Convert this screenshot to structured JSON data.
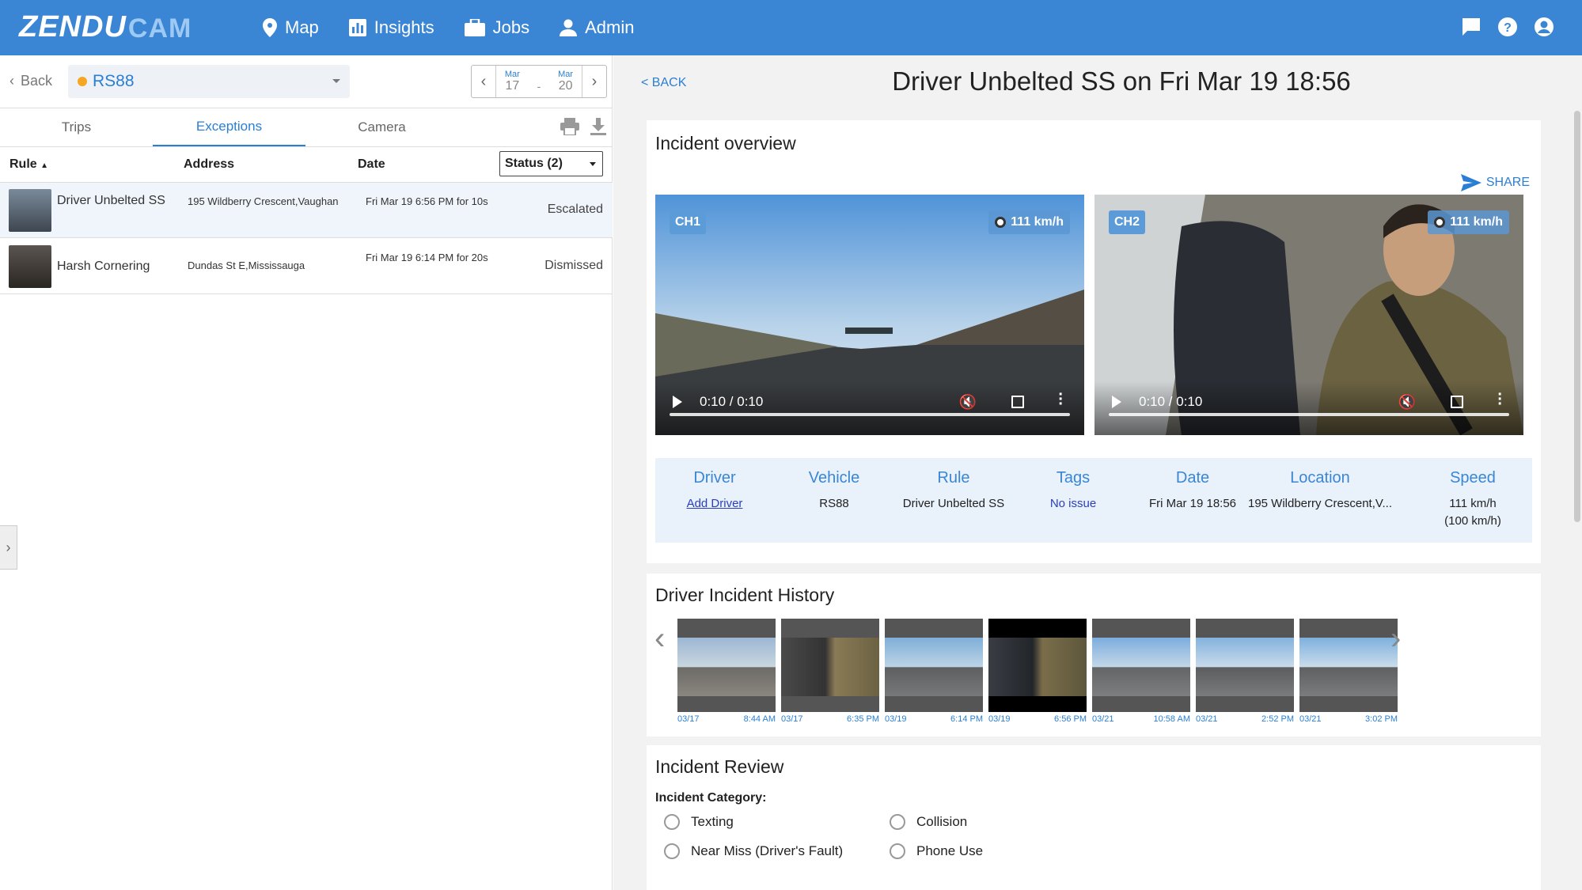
{
  "brand": {
    "part1": "ZENDU",
    "part2": "CAM"
  },
  "nav": [
    {
      "label": "Map",
      "icon": "map-pin-icon"
    },
    {
      "label": "Insights",
      "icon": "bar-chart-icon"
    },
    {
      "label": "Jobs",
      "icon": "briefcase-icon"
    },
    {
      "label": "Admin",
      "icon": "user-icon"
    }
  ],
  "left": {
    "back_label": "Back",
    "vehicle": "RS88",
    "date_from": {
      "month": "Mar",
      "day": "17"
    },
    "date_to": {
      "month": "Mar",
      "day": "20"
    },
    "date_sep": "-",
    "tabs": [
      "Trips",
      "Exceptions",
      "Camera"
    ],
    "columns": {
      "rule": "Rule",
      "address": "Address",
      "date": "Date",
      "status_filter": "Status (2)"
    },
    "rows": [
      {
        "rule": "Driver Unbelted SS",
        "address": "195 Wildberry Crescent,Vaughan",
        "date": "Fri Mar 19 6:56 PM for 10s",
        "status": "Escalated"
      },
      {
        "rule": "Harsh Cornering",
        "address": "Dundas St E,Mississauga",
        "date": "Fri Mar 19 6:14 PM for 20s",
        "status": "Dismissed"
      }
    ]
  },
  "right": {
    "back_label": "< BACK",
    "title": "Driver Unbelted SS on Fri Mar 19 18:56",
    "overview": {
      "heading": "Incident overview",
      "share_label": "SHARE",
      "videos": [
        {
          "channel": "CH1",
          "speed": "111 km/h",
          "time": "0:10 / 0:10"
        },
        {
          "channel": "CH2",
          "speed": "111 km/h",
          "time": "0:10 / 0:10"
        }
      ],
      "info": {
        "driver": {
          "label": "Driver",
          "value": "Add Driver"
        },
        "vehicle": {
          "label": "Vehicle",
          "value": "RS88"
        },
        "rule": {
          "label": "Rule",
          "value": "Driver Unbelted SS"
        },
        "tags": {
          "label": "Tags",
          "value": "No issue"
        },
        "date": {
          "label": "Date",
          "value": "Fri Mar 19 18:56"
        },
        "location": {
          "label": "Location",
          "value": "195 Wildberry Crescent,V..."
        },
        "speed": {
          "label": "Speed",
          "value": "111 km/h",
          "value2": "(100 km/h)"
        }
      }
    },
    "history": {
      "heading": "Driver Incident History",
      "items": [
        {
          "date": "03/17",
          "time": "8:44 AM"
        },
        {
          "date": "03/17",
          "time": "6:35 PM"
        },
        {
          "date": "03/19",
          "time": "6:14 PM"
        },
        {
          "date": "03/19",
          "time": "6:56 PM"
        },
        {
          "date": "03/21",
          "time": "10:58 AM"
        },
        {
          "date": "03/21",
          "time": "2:52 PM"
        },
        {
          "date": "03/21",
          "time": "3:02 PM"
        }
      ]
    },
    "review": {
      "heading": "Incident Review",
      "category_label": "Incident Category:",
      "options": [
        "Texting",
        "Collision",
        "Near Miss (Driver's Fault)",
        "Phone Use"
      ]
    }
  },
  "colors": {
    "accent": "#3a86d5",
    "link": "#2a7fd4"
  }
}
